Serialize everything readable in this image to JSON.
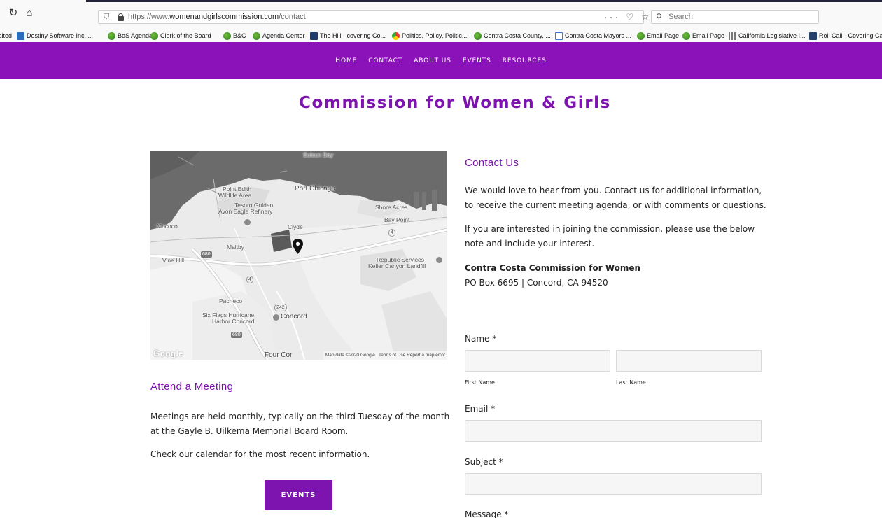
{
  "browser": {
    "url_prefix": "https://www.",
    "url_domain": "womenandgirlscommission.com",
    "url_path": "/contact",
    "page_actions": "··· ♡ ☆",
    "search_placeholder": "Search",
    "bookmarks": [
      {
        "label": "isited",
        "icon": "none"
      },
      {
        "label": "Destiny Software Inc. ...",
        "icon": "blue-square-icon"
      },
      {
        "label": "BoS Agendas",
        "icon": "globe-icon"
      },
      {
        "label": "Clerk of the Board",
        "icon": "globe-icon"
      },
      {
        "label": "B&C",
        "icon": "globe-icon"
      },
      {
        "label": "Agenda Center",
        "icon": "globe-icon"
      },
      {
        "label": "The Hill - covering Co...",
        "icon": "dark-square-icon"
      },
      {
        "label": "Politics, Policy, Politic...",
        "icon": "chrome-icon"
      },
      {
        "label": "Contra Costa County, ...",
        "icon": "globe-icon"
      },
      {
        "label": "Contra Costa Mayors ...",
        "icon": "doc-icon"
      },
      {
        "label": "Email Page",
        "icon": "globe-icon"
      },
      {
        "label": "Email Page",
        "icon": "globe-icon"
      },
      {
        "label": "California Legislative I...",
        "icon": "columns-icon"
      },
      {
        "label": "Roll Call - Covering Ca",
        "icon": "rollcall-icon"
      }
    ]
  },
  "nav": {
    "items": [
      "HOME",
      "CONTACT",
      "ABOUT US",
      "EVENTS",
      "RESOURCES"
    ]
  },
  "page": {
    "title": "Commission for Women & Girls"
  },
  "map": {
    "labels": [
      "Suisun Bay",
      "Point Edith",
      "Wildlife Area",
      "Port Chicago",
      "Tesoro Golden",
      "Avon Eagle Refinery",
      "Shore Acres",
      "Bay Point",
      "Mococo",
      "Clyde",
      "Maltby",
      "Vine Hill",
      "Republic Services",
      "Keller Canyon Landfill",
      "Pacheco",
      "Six Flags Hurricane",
      "Harbor Concord",
      "Concord",
      "Four Cor"
    ],
    "shields": [
      "680",
      "4",
      "4",
      "242",
      "680"
    ],
    "attribution": "Map data ©2020 Google  |  Terms of Use  Report a map error",
    "google_logo": "Google"
  },
  "meeting": {
    "heading": "Attend a Meeting",
    "para1_line1": "Meetings are held monthly, typically on the third Tuesday of the month",
    "para1_line2": "at the Gayle B. Uilkema Memorial Board Room.",
    "para2": "Check our calendar for the most recent information.",
    "button": "EVENTS"
  },
  "contact": {
    "heading": "Contact Us",
    "para1_line1": "We would love to hear from you. Contact us for additional information,",
    "para1_line2": "to receive the current meeting agenda, or with comments or questions.",
    "para2_line1": "If you are interested in joining the commission, please use the below",
    "para2_line2": "note and include your interest.",
    "org_name": "Contra Costa Commission for Women",
    "address": "PO Box 6695 | Concord, CA 94520"
  },
  "form": {
    "name_label": "Name *",
    "first_name_label": "First Name",
    "last_name_label": "Last Name",
    "email_label": "Email *",
    "subject_label": "Subject *",
    "message_label": "Message *"
  }
}
